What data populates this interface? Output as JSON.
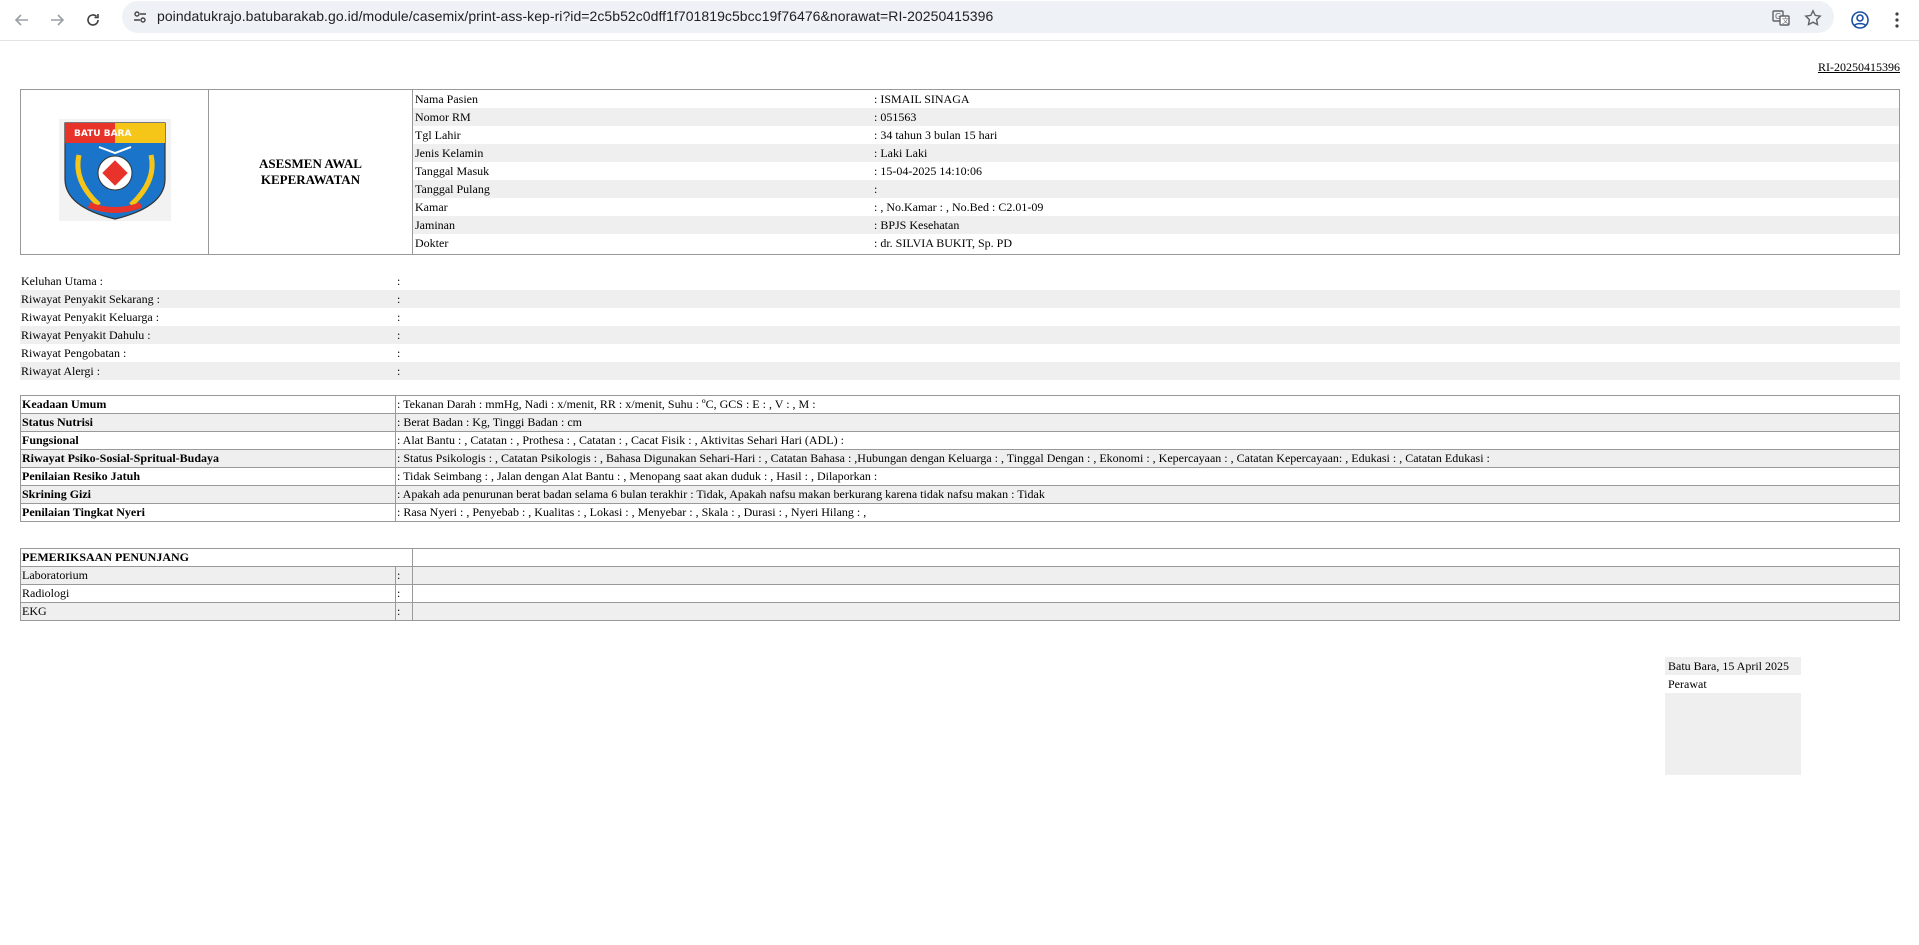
{
  "browser": {
    "url": "poindatukrajo.batubarakab.go.id/module/casemix/print-ass-kep-ri?id=2c5b52c0dff1f701819c5bcc19f76476&norawat=RI-20250415396"
  },
  "doc": {
    "norawat": "RI-20250415396",
    "logo_text": "BATU BARA",
    "title_line1": "ASESMEN AWAL",
    "title_line2": "KEPERAWATAN",
    "patient": [
      {
        "label": "Nama Pasien",
        "value": ": ISMAIL SINAGA"
      },
      {
        "label": "Nomor RM",
        "value": ": 051563"
      },
      {
        "label": "Tgl Lahir",
        "value": ": 34 tahun 3 bulan 15 hari"
      },
      {
        "label": "Jenis Kelamin",
        "value": ": Laki Laki"
      },
      {
        "label": "Tanggal Masuk",
        "value": ": 15-04-2025 14:10:06"
      },
      {
        "label": "Tanggal Pulang",
        "value": ":"
      },
      {
        "label": "Kamar",
        "value": ": , No.Kamar : , No.Bed : C2.01-09"
      },
      {
        "label": "Jaminan",
        "value": ": BPJS Kesehatan"
      },
      {
        "label": "Dokter",
        "value": ": dr. SILVIA BUKIT, Sp. PD"
      }
    ],
    "history": [
      {
        "label": "Keluhan Utama :",
        "colon": ":"
      },
      {
        "label": "Riwayat Penyakit Sekarang :",
        "colon": ":"
      },
      {
        "label": "Riwayat Penyakit Keluarga :",
        "colon": ":"
      },
      {
        "label": "Riwayat Penyakit Dahulu :",
        "colon": ":"
      },
      {
        "label": "Riwayat Pengobatan :",
        "colon": ":"
      },
      {
        "label": "Riwayat Alergi :",
        "colon": ":"
      }
    ],
    "assessment": [
      {
        "label": "Keadaan Umum",
        "value": ": Tekanan Darah : mmHg, Nadi : x/menit, RR : x/menit, Suhu : ºC, GCS : E : , V : , M :"
      },
      {
        "label": "Status Nutrisi",
        "value": ": Berat Badan : Kg, Tinggi Badan : cm"
      },
      {
        "label": "Fungsional",
        "value": ": Alat Bantu : , Catatan : , Prothesa : , Catatan : , Cacat Fisik : , Aktivitas Sehari Hari (ADL) :"
      },
      {
        "label": "Riwayat Psiko-Sosial-Spritual-Budaya",
        "value": ": Status Psikologis : , Catatan Psikologis : , Bahasa Digunakan Sehari-Hari : , Catatan Bahasa : ,Hubungan dengan Keluarga : , Tinggal Dengan : , Ekonomi : , Kepercayaan : , Catatan Kepercayaan: , Edukasi : , Catatan Edukasi :"
      },
      {
        "label": "Penilaian Resiko Jatuh",
        "value": ": Tidak Seimbang : , Jalan dengan Alat Bantu : , Menopang saat akan duduk : , Hasil : , Dilaporkan :"
      },
      {
        "label": "Skrining Gizi",
        "value": ": Apakah ada penurunan berat badan selama 6 bulan terakhir : Tidak, Apakah nafsu makan berkurang karena tidak nafsu makan : Tidak"
      },
      {
        "label": "Penilaian Tingkat Nyeri",
        "value": ": Rasa Nyeri : , Penyebab : , Kualitas : , Lokasi : , Menyebar : , Skala : , Durasi : , Nyeri Hilang : ,"
      }
    ],
    "penunjang": {
      "title": "PEMERIKSAAN PENUNJANG",
      "rows": [
        {
          "label": "Laboratorium",
          "colon": ":"
        },
        {
          "label": "Radiologi",
          "colon": ":"
        },
        {
          "label": "EKG",
          "colon": ":"
        }
      ]
    },
    "sign": {
      "date": "Batu Bara, 15 April 2025",
      "role": "Perawat"
    }
  }
}
